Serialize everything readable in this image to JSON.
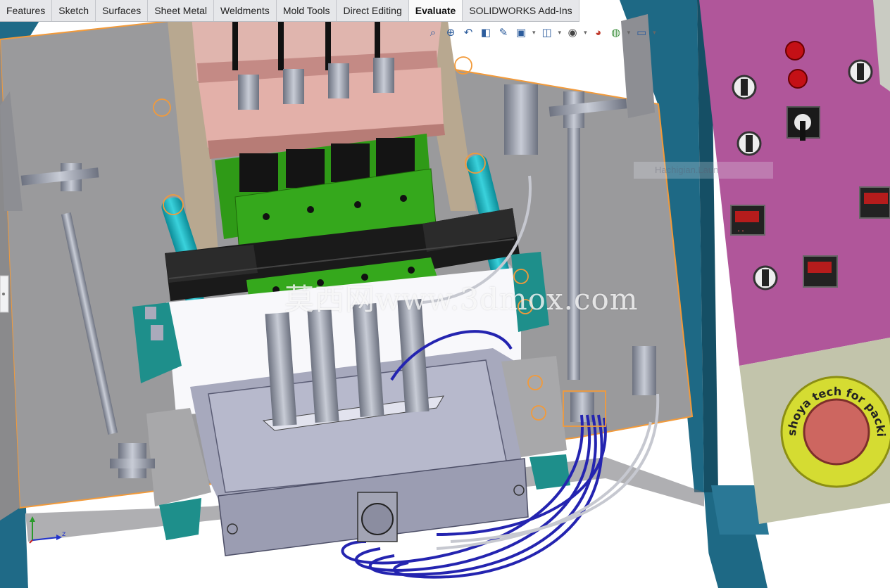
{
  "toolbar": {
    "tabs": [
      {
        "label": "Features",
        "active": false
      },
      {
        "label": "Sketch",
        "active": false
      },
      {
        "label": "Surfaces",
        "active": false
      },
      {
        "label": "Sheet Metal",
        "active": false
      },
      {
        "label": "Weldments",
        "active": false
      },
      {
        "label": "Mold Tools",
        "active": false
      },
      {
        "label": "Direct Editing",
        "active": false
      },
      {
        "label": "Evaluate",
        "active": true
      },
      {
        "label": "SOLIDWORKS Add-Ins",
        "active": false
      }
    ]
  },
  "heads_up_toolbar": {
    "icons": [
      "zoom-to-fit-icon",
      "zoom-to-area-icon",
      "previous-view-icon",
      "section-view-icon",
      "dynamic-annotation-icon",
      "view-orientation-icon",
      "display-style-icon",
      "hide-show-items-icon",
      "edit-appearance-icon",
      "apply-scene-icon",
      "view-settings-icon"
    ]
  },
  "viewport": {
    "watermark": "莫西网www.3dmox.com",
    "faded_label": "Hachigian.Laun",
    "seal_text": "shoya tech for packing and filling machines",
    "triad_axis_label": "z",
    "colors": {
      "background": "#ffffff",
      "panel_magenta": "#b0569a",
      "frame_blue": "#1f6a87",
      "plate_gray": "#9a9a9c",
      "mold_green": "#2f9a17",
      "block_pink": "#cf8a84",
      "clamp_black": "#1a1a1a",
      "bracket_teal": "#1e8f8b",
      "hose_blue": "#2424b0",
      "selection_orange": "#f29a3a",
      "seal_yellow": "#d5dc32"
    }
  }
}
